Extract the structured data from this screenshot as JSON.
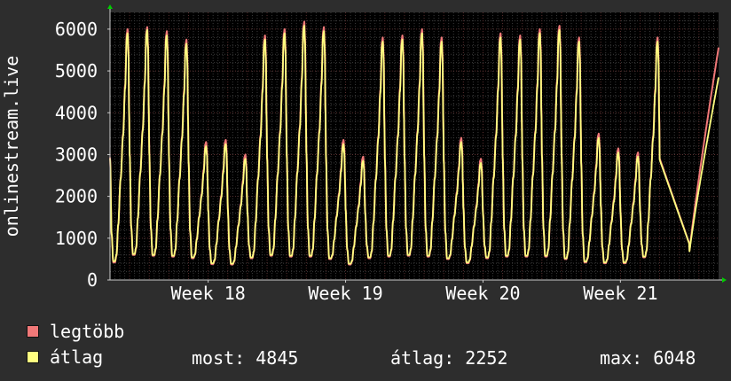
{
  "chart_data": {
    "type": "line",
    "ylabel": "onlinestream.live",
    "ylim": [
      0,
      6400
    ],
    "yticks": [
      0,
      1000,
      2000,
      3000,
      4000,
      5000,
      6000
    ],
    "yticklabels": [
      "0",
      "1000",
      "2000",
      "3000",
      "4000",
      "5000",
      "6000"
    ],
    "xlim_days": [
      0,
      31
    ],
    "xticks": [
      {
        "label": "Week 18",
        "day": 5
      },
      {
        "label": "Week 19",
        "day": 12
      },
      {
        "label": "Week 20",
        "day": 19
      },
      {
        "label": "Week 21",
        "day": 26
      }
    ],
    "grid": true,
    "legend_position": "bottom-left",
    "series": [
      {
        "name": "legtöbb",
        "color": "#f07878",
        "daily_peaks": [
          6000,
          6050,
          5950,
          5750,
          3300,
          3350,
          3000,
          5850,
          6000,
          6180,
          6050,
          3350,
          2950,
          5800,
          5850,
          6000,
          5800,
          3400,
          2900,
          5900,
          5850,
          6000,
          6080,
          5800,
          3500,
          3150,
          3050,
          5800
        ],
        "daily_lows": [
          420,
          600,
          580,
          560,
          520,
          380,
          370,
          520,
          580,
          560,
          560,
          500,
          370,
          520,
          560,
          580,
          560,
          500,
          400,
          520,
          560,
          560,
          560,
          500,
          420,
          400,
          400,
          540
        ],
        "last_value": 5560
      },
      {
        "name": "átlag",
        "color": "#ffff80",
        "daily_peaks": [
          5900,
          5980,
          5850,
          5650,
          3200,
          3250,
          2900,
          5750,
          5900,
          6080,
          5950,
          3250,
          2850,
          5700,
          5750,
          5900,
          5700,
          3300,
          2800,
          5800,
          5750,
          5900,
          5980,
          5700,
          3400,
          3050,
          2950,
          5700
        ],
        "daily_lows": [
          450,
          620,
          600,
          580,
          540,
          400,
          390,
          540,
          600,
          580,
          580,
          520,
          390,
          540,
          580,
          600,
          580,
          520,
          420,
          540,
          580,
          580,
          580,
          520,
          440,
          420,
          420,
          560
        ],
        "last_value": 4845
      }
    ]
  },
  "legend": [
    {
      "label": "legtöbb",
      "color": "#f07878"
    },
    {
      "label": "átlag",
      "color": "#ffff80"
    }
  ],
  "stats": {
    "most": "most: 4845",
    "atlag": "átlag: 2252",
    "max": "max: 6048"
  }
}
